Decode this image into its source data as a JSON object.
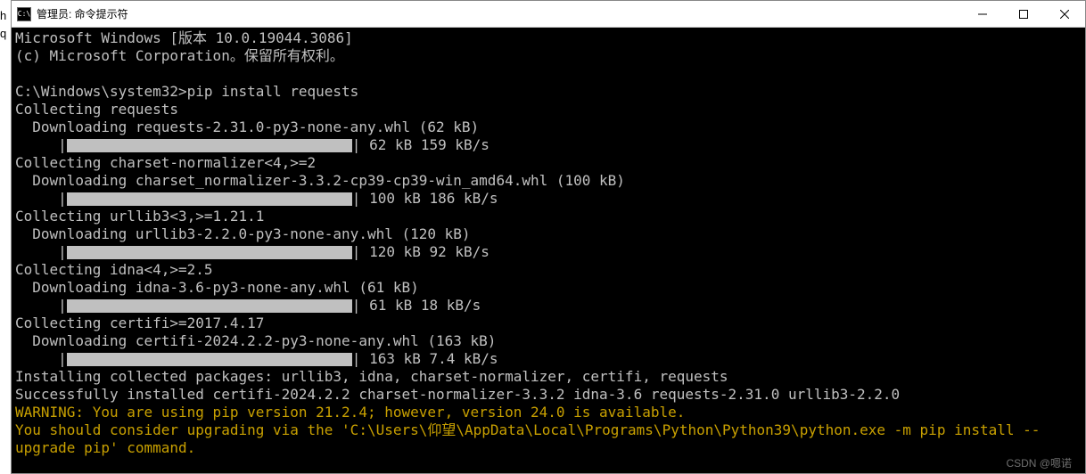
{
  "left_chars": "h\n\n\n\n\n\n\n\n\n\n\n\n\n\n\n\n\n\nq",
  "titlebar": {
    "icon_text": "C:\\",
    "title": "管理员: 命令提示符"
  },
  "terminal": {
    "header_line1": "Microsoft Windows [版本 10.0.19044.3086]",
    "header_line2": "(c) Microsoft Corporation。保留所有权利。",
    "prompt_line": "C:\\Windows\\system32>pip install requests",
    "collect1": "Collecting requests",
    "dl1": "  Downloading requests-2.31.0-py3-none-any.whl (62 kB)",
    "prog1_indent": "     |",
    "prog1_text": " 62 kB 159 kB/s",
    "collect2": "Collecting charset-normalizer<4,>=2",
    "dl2": "  Downloading charset_normalizer-3.3.2-cp39-cp39-win_amd64.whl (100 kB)",
    "prog2_indent": "     |",
    "prog2_text": " 100 kB 186 kB/s",
    "collect3": "Collecting urllib3<3,>=1.21.1",
    "dl3": "  Downloading urllib3-2.2.0-py3-none-any.whl (120 kB)",
    "prog3_indent": "     |",
    "prog3_text": " 120 kB 92 kB/s",
    "collect4": "Collecting idna<4,>=2.5",
    "dl4": "  Downloading idna-3.6-py3-none-any.whl (61 kB)",
    "prog4_indent": "     |",
    "prog4_text": " 61 kB 18 kB/s",
    "collect5": "Collecting certifi>=2017.4.17",
    "dl5": "  Downloading certifi-2024.2.2-py3-none-any.whl (163 kB)",
    "prog5_indent": "     |",
    "prog5_text": " 163 kB 7.4 kB/s",
    "install_line": "Installing collected packages: urllib3, idna, charset-normalizer, certifi, requests",
    "success_line": "Successfully installed certifi-2024.2.2 charset-normalizer-3.3.2 idna-3.6 requests-2.31.0 urllib3-2.2.0",
    "warn1": "WARNING: You are using pip version 21.2.4; however, version 24.0 is available.",
    "warn2": "You should consider upgrading via the 'C:\\Users\\仰望\\AppData\\Local\\Programs\\Python\\Python39\\python.exe -m pip install --",
    "warn3": "upgrade pip' command."
  },
  "watermark": "CSDN @嗯诺"
}
